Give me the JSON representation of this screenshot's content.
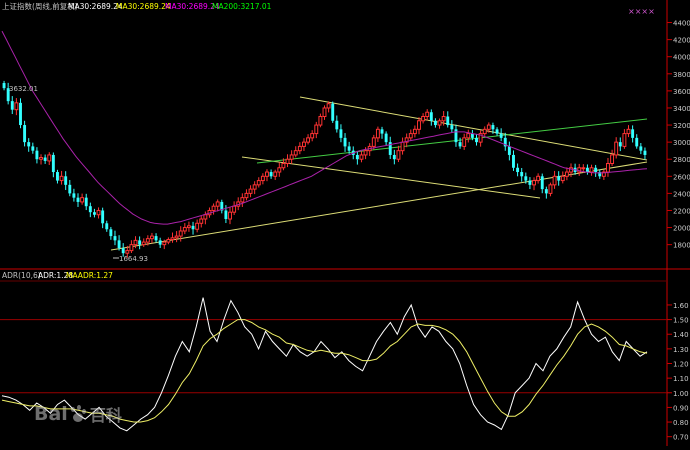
{
  "header": {
    "symbol_label": "上证指数(周线,前复权)",
    "ma_items": [
      {
        "text": "MA30:2689.24",
        "color": "#ffffff"
      },
      {
        "text": "MA30:2689.24",
        "color": "#ffff00"
      },
      {
        "text": "MA30:2689.24",
        "color": "#ff00ff"
      },
      {
        "text": "MA200:3217.01",
        "color": "#00ff00"
      }
    ],
    "marker_text": "××××"
  },
  "sub_header": {
    "items": [
      {
        "text": "ADR(10,6)",
        "color": "#c0c0c0"
      },
      {
        "text": "ADR:1.28",
        "color": "#ffffff"
      },
      {
        "text": "MAADR:1.27",
        "color": "#ffff00"
      }
    ]
  },
  "annotations": {
    "high": "3632.01",
    "low": "1664.93"
  },
  "watermark": {
    "text1": "Bai",
    "text2": "百科"
  },
  "colors": {
    "up": "#ff3333",
    "down": "#33ffff",
    "grid": "#990000",
    "axis": "#cc0000",
    "ma_line": "#aa22aa",
    "adr_line": "#ffffff",
    "maadr_line": "#eeee66",
    "trend_yellow": "#dddd77",
    "trend_green": "#44cc44"
  },
  "chart_data": [
    {
      "type": "candlestick",
      "title": "上证指数(周线,前复权)",
      "ylim": [
        1550,
        4500
      ],
      "yticks": [
        1800,
        2000,
        2200,
        2400,
        2600,
        2800,
        3000,
        3200,
        3400,
        3600,
        3800,
        4000,
        4200,
        4400
      ],
      "ytick_labels": [
        "1800",
        "2000",
        "2200",
        "2400",
        "2600",
        "2800",
        "3000",
        "3200",
        "3400",
        "3600",
        "3800",
        "4000",
        "4200",
        "4400"
      ],
      "close": [
        3632,
        3480,
        3380,
        3460,
        3200,
        3000,
        2950,
        2900,
        2800,
        2820,
        2780,
        2850,
        2650,
        2550,
        2600,
        2500,
        2400,
        2350,
        2300,
        2350,
        2250,
        2180,
        2150,
        2200,
        2050,
        1980,
        1900,
        1850,
        1760,
        1700,
        1730,
        1800,
        1850,
        1800,
        1830,
        1870,
        1900,
        1850,
        1800,
        1830,
        1860,
        1880,
        1900,
        1960,
        2000,
        2020,
        1980,
        2050,
        2100,
        2150,
        2200,
        2250,
        2300,
        2200,
        2100,
        2180,
        2250,
        2300,
        2350,
        2400,
        2450,
        2500,
        2550,
        2600,
        2650,
        2600,
        2650,
        2700,
        2750,
        2800,
        2850,
        2900,
        2950,
        3000,
        3050,
        3100,
        3200,
        3300,
        3400,
        3450,
        3250,
        3150,
        3050,
        2950,
        2900,
        2850,
        2800,
        2850,
        2900,
        2950,
        3050,
        3150,
        3100,
        3000,
        2850,
        2800,
        2900,
        3000,
        3050,
        3100,
        3150,
        3250,
        3300,
        3350,
        3250,
        3200,
        3250,
        3300,
        3200,
        3150,
        3000,
        2950,
        3050,
        3100,
        3050,
        3000,
        3100,
        3150,
        3200,
        3150,
        3100,
        3050,
        2950,
        2850,
        2700,
        2650,
        2600,
        2550,
        2500,
        2550,
        2600,
        2450,
        2400,
        2500,
        2600,
        2550,
        2600,
        2650,
        2700,
        2650,
        2700,
        2700,
        2650,
        2700,
        2650,
        2600,
        2650,
        2750,
        2850,
        3000,
        2950,
        3100,
        3150,
        3050,
        2950,
        2900,
        2850
      ],
      "annotations": [
        "3632.01",
        "1664.93"
      ],
      "series": [
        {
          "name": "MA30",
          "values": [
            4300,
            4200,
            4100,
            4000,
            3900,
            3800,
            3700,
            3600,
            3520,
            3440,
            3360,
            3280,
            3200,
            3120,
            3040,
            2970,
            2900,
            2830,
            2770,
            2710,
            2650,
            2590,
            2530,
            2480,
            2430,
            2380,
            2330,
            2280,
            2240,
            2200,
            2160,
            2130,
            2100,
            2080,
            2060,
            2050,
            2045,
            2040,
            2040,
            2050,
            2060,
            2070,
            2085,
            2100,
            2115,
            2130,
            2145,
            2160,
            2175,
            2190,
            2205,
            2220,
            2235,
            2250,
            2265,
            2280,
            2300,
            2320,
            2340,
            2360,
            2380,
            2400,
            2420,
            2440,
            2460,
            2480,
            2500,
            2520,
            2540,
            2560,
            2580,
            2600,
            2630,
            2660,
            2690,
            2720,
            2750,
            2780,
            2810,
            2840,
            2860,
            2880,
            2900,
            2910,
            2920,
            2930,
            2940,
            2950,
            2960,
            2970,
            2980,
            2990,
            3000,
            3010,
            3020,
            3030,
            3040,
            3050,
            3060,
            3070,
            3080,
            3090,
            3100,
            3110,
            3120,
            3120,
            3120,
            3110,
            3100,
            3090,
            3080,
            3060,
            3040,
            3020,
            3000,
            2980,
            2960,
            2940,
            2920,
            2900,
            2880,
            2860,
            2840,
            2820,
            2800,
            2780,
            2760,
            2740,
            2720,
            2700,
            2690,
            2680,
            2670,
            2660,
            2650,
            2645,
            2640,
            2640,
            2640,
            2645,
            2650,
            2655,
            2660,
            2665,
            2670,
            2675,
            2680,
            2685,
            2689
          ]
        }
      ]
    },
    {
      "type": "line",
      "title": "ADR(10,6)",
      "ylim": [
        0.65,
        1.75
      ],
      "yticks": [
        0.7,
        0.8,
        0.9,
        1.0,
        1.1,
        1.2,
        1.3,
        1.4,
        1.5,
        1.6
      ],
      "ytick_labels": [
        "0.70",
        "0.80",
        "0.90",
        "1.00",
        "1.10",
        "1.20",
        "1.30",
        "1.40",
        "1.50",
        "1.60"
      ],
      "series": [
        {
          "name": "ADR",
          "values": [
            0.98,
            0.97,
            0.95,
            0.92,
            0.88,
            0.93,
            0.9,
            0.86,
            0.92,
            0.95,
            0.9,
            0.85,
            0.82,
            0.86,
            0.9,
            0.84,
            0.8,
            0.76,
            0.74,
            0.78,
            0.82,
            0.85,
            0.9,
            1.0,
            1.12,
            1.25,
            1.35,
            1.28,
            1.45,
            1.65,
            1.42,
            1.35,
            1.5,
            1.63,
            1.55,
            1.45,
            1.4,
            1.3,
            1.42,
            1.35,
            1.3,
            1.25,
            1.33,
            1.28,
            1.25,
            1.28,
            1.35,
            1.3,
            1.24,
            1.28,
            1.22,
            1.18,
            1.15,
            1.25,
            1.35,
            1.42,
            1.48,
            1.4,
            1.52,
            1.6,
            1.45,
            1.38,
            1.45,
            1.42,
            1.35,
            1.3,
            1.2,
            1.05,
            0.92,
            0.85,
            0.8,
            0.78,
            0.75,
            0.85,
            1.0,
            1.05,
            1.1,
            1.2,
            1.15,
            1.25,
            1.3,
            1.38,
            1.45,
            1.62,
            1.5,
            1.4,
            1.35,
            1.38,
            1.28,
            1.22,
            1.35,
            1.3,
            1.25,
            1.28
          ]
        },
        {
          "name": "MAADR",
          "values": [
            0.95,
            0.94,
            0.93,
            0.92,
            0.91,
            0.91,
            0.9,
            0.89,
            0.89,
            0.89,
            0.89,
            0.88,
            0.87,
            0.86,
            0.86,
            0.85,
            0.84,
            0.82,
            0.81,
            0.8,
            0.8,
            0.81,
            0.83,
            0.87,
            0.92,
            0.99,
            1.07,
            1.13,
            1.22,
            1.32,
            1.37,
            1.4,
            1.44,
            1.47,
            1.5,
            1.5,
            1.48,
            1.45,
            1.43,
            1.4,
            1.38,
            1.34,
            1.33,
            1.31,
            1.29,
            1.28,
            1.29,
            1.28,
            1.27,
            1.27,
            1.26,
            1.24,
            1.22,
            1.22,
            1.23,
            1.27,
            1.32,
            1.35,
            1.4,
            1.45,
            1.47,
            1.46,
            1.46,
            1.45,
            1.43,
            1.4,
            1.35,
            1.28,
            1.19,
            1.1,
            1.01,
            0.93,
            0.87,
            0.84,
            0.84,
            0.87,
            0.92,
            0.99,
            1.05,
            1.12,
            1.19,
            1.25,
            1.32,
            1.4,
            1.45,
            1.47,
            1.45,
            1.42,
            1.38,
            1.33,
            1.32,
            1.3,
            1.28,
            1.27
          ]
        }
      ]
    }
  ]
}
